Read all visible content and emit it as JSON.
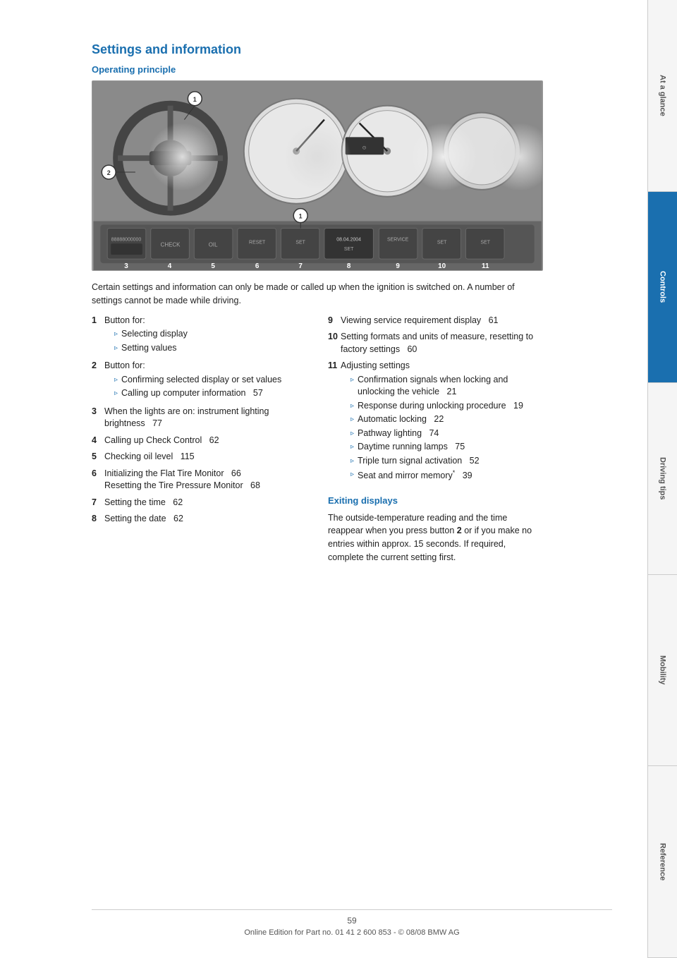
{
  "page": {
    "title": "Settings and information",
    "subtitle_operating": "Operating principle",
    "subtitle_exiting": "Exiting displays",
    "page_number": "59",
    "footer_text": "Online Edition for Part no. 01 41 2 600 853 - © 08/08 BMW AG"
  },
  "sidebar": {
    "tabs": [
      {
        "label": "At a glance",
        "active": false
      },
      {
        "label": "Controls",
        "active": true
      },
      {
        "label": "Driving tips",
        "active": false
      },
      {
        "label": "Mobility",
        "active": false
      },
      {
        "label": "Reference",
        "active": false
      }
    ]
  },
  "intro_paragraph": "Certain settings and information can only be made or called up when the ignition is switched on. A number of settings cannot be made while driving.",
  "left_column_items": [
    {
      "num": "1",
      "text": "Button for:",
      "bullets": [
        "Selecting display",
        "Setting values"
      ]
    },
    {
      "num": "2",
      "text": "Button for:",
      "bullets": [
        "Confirming selected display or set values",
        "Calling up computer information   57"
      ]
    },
    {
      "num": "3",
      "text": "When the lights are on: instrument lighting brightness   77",
      "bullets": []
    },
    {
      "num": "4",
      "text": "Calling up Check Control   62",
      "bullets": []
    },
    {
      "num": "5",
      "text": "Checking oil level   115",
      "bullets": []
    },
    {
      "num": "6",
      "text": "Initializing the Flat Tire Monitor   66\nResetting the Tire Pressure Monitor   68",
      "bullets": []
    },
    {
      "num": "7",
      "text": "Setting the time   62",
      "bullets": []
    },
    {
      "num": "8",
      "text": "Setting the date   62",
      "bullets": []
    }
  ],
  "right_column_items": [
    {
      "num": "9",
      "text": "Viewing service requirement display   61",
      "bullets": []
    },
    {
      "num": "10",
      "text": "Setting formats and units of measure, resetting to factory settings   60",
      "bullets": []
    },
    {
      "num": "11",
      "text": "Adjusting settings",
      "bullets": [
        "Confirmation signals when locking and unlocking the vehicle   21",
        "Response during unlocking procedure   19",
        "Automatic locking   22",
        "Pathway lighting   74",
        "Daytime running lamps   75",
        "Triple turn signal activation   52",
        "Seat and mirror memory*   39"
      ]
    }
  ],
  "exiting_paragraph": "The outside-temperature reading and the time reappear when you press button 2 or if you make no entries within approx. 15 seconds. If required, complete the current setting first.",
  "dash_numbers": [
    "3",
    "4",
    "5",
    "6",
    "7",
    "8",
    "9",
    "10",
    "11"
  ],
  "annot_labels": [
    "1",
    "2",
    "1"
  ]
}
